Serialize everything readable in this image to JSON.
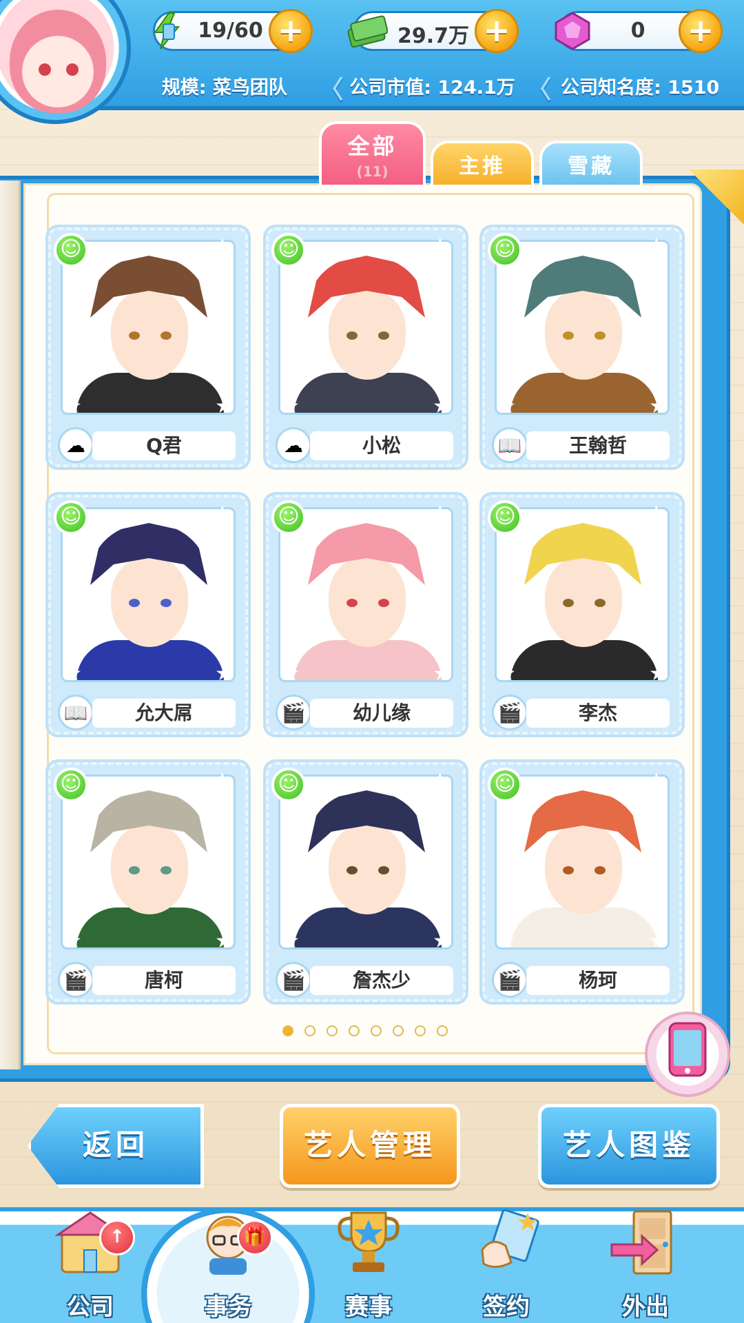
{
  "hud": {
    "energy": {
      "value": "19/60",
      "icon": "hourglass-lightning-icon"
    },
    "money": {
      "value": "29.7万",
      "icon": "money-stack-icon"
    },
    "gems": {
      "value": "0",
      "icon": "gem-icon"
    },
    "plus_label": "+",
    "info": {
      "scale": "规模: 菜鸟团队",
      "market_value": "公司市值: 124.1万",
      "fame": "公司知名度: 1510"
    }
  },
  "tabs": [
    {
      "label": "全部",
      "count": "(11)",
      "active": true
    },
    {
      "label": "主推",
      "active": false
    },
    {
      "label": "雪藏",
      "active": false
    }
  ],
  "artists": [
    {
      "name": "Q君",
      "type_icon": "cloud-icon",
      "mood": "happy",
      "hair": "#7a4e32",
      "clothes": "#2e2e2e",
      "eyes": "#b5742c"
    },
    {
      "name": "小松",
      "type_icon": "cloud-icon",
      "mood": "happy",
      "hair": "#e24c45",
      "clothes": "#3d4152",
      "eyes": "#7d6a3a"
    },
    {
      "name": "王翰哲",
      "type_icon": "book-icon",
      "mood": "happy",
      "hair": "#4f7c7a",
      "clothes": "#9a6430",
      "eyes": "#c0902a"
    },
    {
      "name": "允大屌",
      "type_icon": "book-icon",
      "mood": "happy",
      "hair": "#2f2f66",
      "clothes": "#2b3aa8",
      "eyes": "#4b61c9"
    },
    {
      "name": "幼儿缘",
      "type_icon": "clapboard-icon",
      "mood": "happy",
      "hair": "#f59aa8",
      "clothes": "#f5c3c8",
      "eyes": "#d4434d"
    },
    {
      "name": "李杰",
      "type_icon": "clapboard-icon",
      "mood": "happy",
      "hair": "#f1d44d",
      "clothes": "#2a2a2a",
      "eyes": "#8a6a2a"
    },
    {
      "name": "唐柯",
      "type_icon": "clapboard-icon",
      "mood": "happy",
      "hair": "#b9b3a4",
      "clothes": "#2f6a36",
      "eyes": "#5c9a8a"
    },
    {
      "name": "詹杰少",
      "type_icon": "clapboard-icon",
      "mood": "happy",
      "hair": "#2e3158",
      "clothes": "#2c3560",
      "eyes": "#6b4a2e"
    },
    {
      "name": "杨珂",
      "type_icon": "clapboard-icon",
      "mood": "happy",
      "hair": "#e46b45",
      "clothes": "#f4efe6",
      "eyes": "#b25a28"
    }
  ],
  "pagination": {
    "current": 1,
    "total": 8
  },
  "actions": {
    "back": "返回",
    "manage": "艺人管理",
    "gallery": "艺人图鉴"
  },
  "phone_icon": "phone-icon",
  "nav": [
    {
      "label": "公司",
      "icon": "company-building-icon",
      "badge": "↑",
      "active": false
    },
    {
      "label": "事务",
      "icon": "manager-icon",
      "badge": "🎁",
      "active": true
    },
    {
      "label": "赛事",
      "icon": "trophy-icon",
      "badge": "",
      "active": false
    },
    {
      "label": "签约",
      "icon": "contract-icon",
      "badge": "",
      "active": false
    },
    {
      "label": "外出",
      "icon": "door-icon",
      "badge": "",
      "active": false
    }
  ]
}
